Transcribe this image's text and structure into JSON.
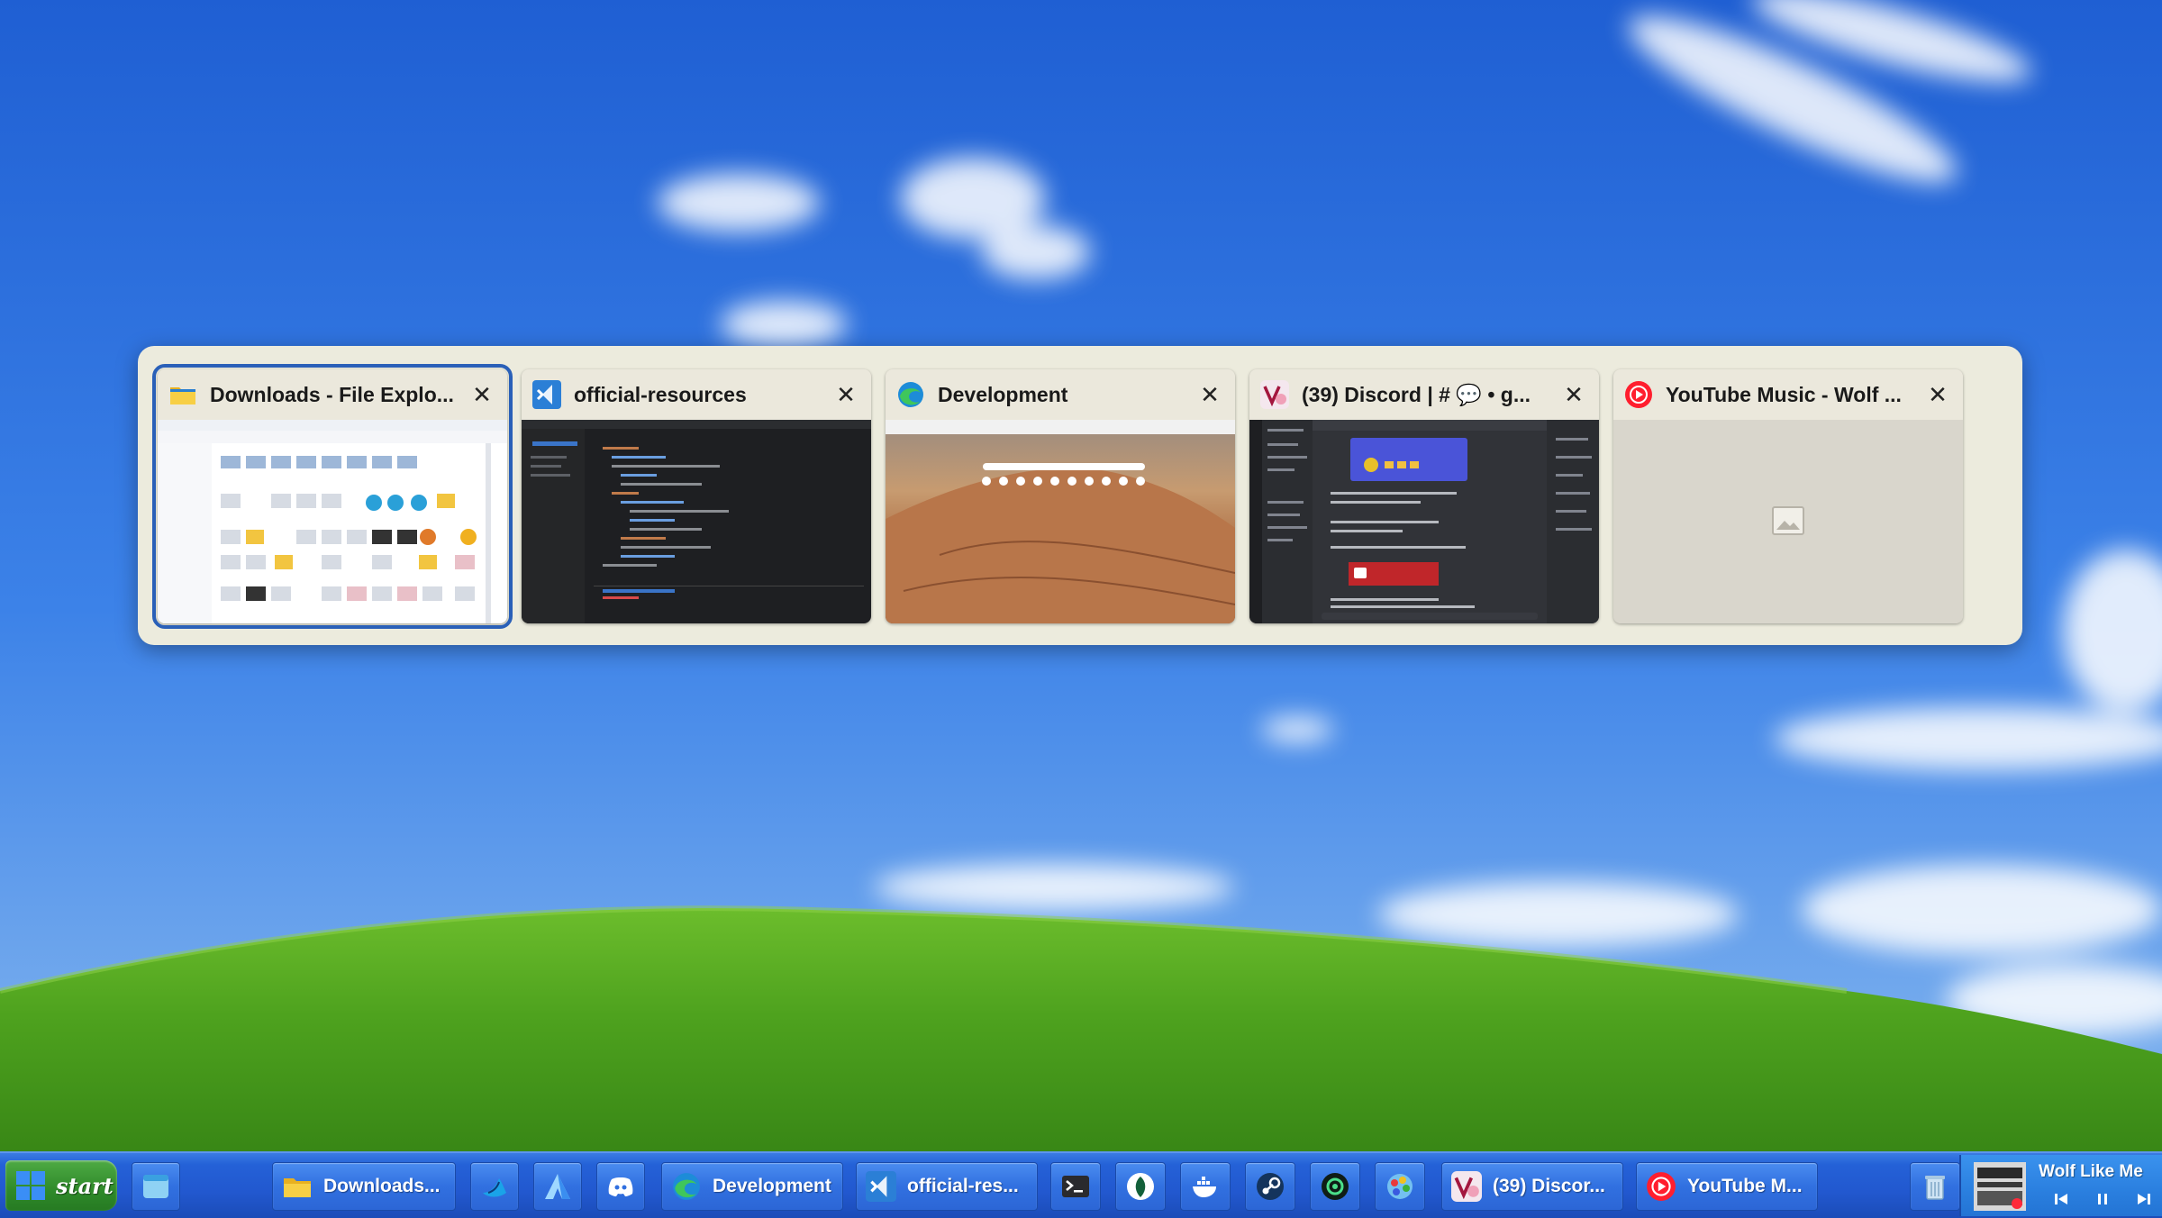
{
  "switcher": {
    "windows": [
      {
        "title": "Downloads - File Explo...",
        "app": "File Explorer",
        "icon": "folder-icon",
        "selected": true
      },
      {
        "title": "official-resources",
        "app": "Visual Studio Code",
        "icon": "vscode-icon",
        "selected": false
      },
      {
        "title": "Development",
        "app": "Microsoft Edge",
        "icon": "edge-icon",
        "selected": false
      },
      {
        "title": "(39) Discord | # 💬 • g...",
        "app": "Vencord Discord",
        "icon": "vencord-icon",
        "selected": false
      },
      {
        "title": "YouTube Music - Wolf ...",
        "app": "YouTube Music",
        "icon": "youtube-music-icon",
        "selected": false
      }
    ],
    "close_glyph": "✕"
  },
  "taskbar": {
    "start_label": "start",
    "buttons": [
      {
        "label": "",
        "icon": "window-icon"
      },
      {
        "label": "Downloads...",
        "icon": "folder-icon"
      },
      {
        "label": "",
        "icon": "bird-app-icon"
      },
      {
        "label": "",
        "icon": "arc-a-icon"
      },
      {
        "label": "",
        "icon": "discord-icon"
      },
      {
        "label": "Development",
        "icon": "edge-icon"
      },
      {
        "label": "official-res...",
        "icon": "vscode-icon"
      },
      {
        "label": "",
        "icon": "terminal-icon"
      },
      {
        "label": "",
        "icon": "leaf-icon"
      },
      {
        "label": "",
        "icon": "docker-icon"
      },
      {
        "label": "",
        "icon": "steam-icon"
      },
      {
        "label": "",
        "icon": "openai-icon"
      },
      {
        "label": "",
        "icon": "paint-icon"
      },
      {
        "label": "(39) Discor...",
        "icon": "vencord-icon"
      },
      {
        "label": "YouTube M...",
        "icon": "youtube-music-icon"
      },
      {
        "label": "",
        "icon": "recycle-bin-icon"
      }
    ],
    "media": {
      "title": "Wolf Like Me",
      "controls": [
        "previous-icon",
        "pause-icon",
        "next-icon"
      ]
    }
  },
  "colors": {
    "accent": "#2a60b8",
    "taskbar": "#2458d0",
    "start": "#3a9a34"
  }
}
